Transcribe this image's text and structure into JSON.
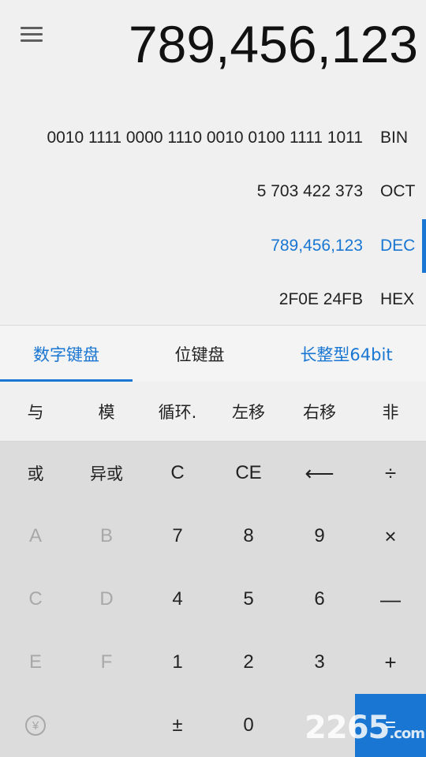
{
  "display": {
    "main_value": "789,456,123",
    "bases": [
      {
        "value": "0010 1111 0000 1110 0010 0100 1111 1011",
        "label": "BIN"
      },
      {
        "value": "5 703 422 373",
        "label": "OCT"
      },
      {
        "value": "789,456,123",
        "label": "DEC"
      },
      {
        "value": "2F0E 24FB",
        "label": "HEX"
      }
    ],
    "active_base": "DEC"
  },
  "tabs": [
    {
      "label": "数字键盘"
    },
    {
      "label": "位键盘"
    },
    {
      "label": "长整型64bit"
    }
  ],
  "bitops": [
    "与",
    "模",
    "循环.",
    "左移",
    "右移",
    "非"
  ],
  "keypad": {
    "row1": [
      "或",
      "异或",
      "C",
      "CE",
      "⟵",
      "÷"
    ],
    "row2": [
      "A",
      "B",
      "7",
      "8",
      "9",
      "×"
    ],
    "row3": [
      "C",
      "D",
      "4",
      "5",
      "6",
      "—"
    ],
    "row4": [
      "E",
      "F",
      "1",
      "2",
      "3",
      "+"
    ],
    "row5": [
      "¥",
      "",
      "±",
      "0",
      "",
      "="
    ]
  },
  "watermark": {
    "text": "2265",
    "suffix": ".com"
  },
  "colors": {
    "accent": "#1976d2",
    "display_bg": "#f0f0f0",
    "keypad_bg": "#dcdcdc"
  }
}
